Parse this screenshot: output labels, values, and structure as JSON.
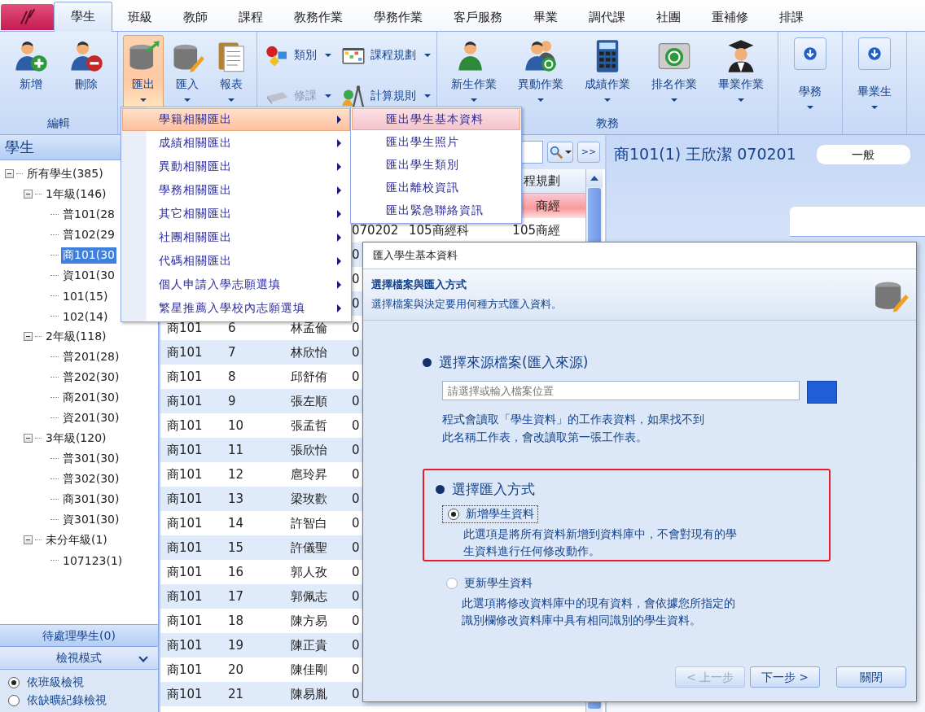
{
  "ribbon": {
    "tabs": [
      {
        "label": "學生",
        "selected": true
      },
      {
        "label": "班級",
        "selected": false
      },
      {
        "label": "教師",
        "selected": false
      },
      {
        "label": "課程",
        "selected": false
      },
      {
        "label": "教務作業",
        "selected": false
      },
      {
        "label": "學務作業",
        "selected": false
      },
      {
        "label": "客戶服務",
        "selected": false
      },
      {
        "label": "畢業",
        "selected": false
      },
      {
        "label": "調代課",
        "selected": false
      },
      {
        "label": "社團",
        "selected": false
      },
      {
        "label": "重補修",
        "selected": false
      },
      {
        "label": "排課",
        "selected": false
      }
    ],
    "groups": [
      {
        "label": "編輯",
        "buttons": [
          {
            "label": "新增",
            "kind": "large",
            "dropdown": false,
            "pressed": false,
            "disabled": false
          },
          {
            "label": "刪除",
            "kind": "large",
            "dropdown": false,
            "pressed": false,
            "disabled": false
          }
        ]
      },
      {
        "buttons": [
          {
            "label": "匯出",
            "kind": "large",
            "dropdown": true,
            "pressed": true,
            "disabled": false
          },
          {
            "label": "匯入",
            "kind": "large",
            "dropdown": true,
            "pressed": false,
            "disabled": false
          },
          {
            "label": "報表",
            "kind": "large",
            "dropdown": true,
            "pressed": false,
            "disabled": false
          }
        ]
      },
      {
        "buttons": [
          {
            "label": "類別",
            "kind": "small",
            "dropdown": true,
            "pressed": false,
            "disabled": false
          },
          {
            "label": "修課",
            "kind": "small",
            "dropdown": true,
            "pressed": false,
            "disabled": true
          },
          {
            "label": "課程規劃",
            "kind": "small",
            "dropdown": true,
            "pressed": false,
            "disabled": false
          },
          {
            "label": "計算規則",
            "kind": "small",
            "dropdown": true,
            "pressed": false,
            "disabled": false
          }
        ]
      },
      {
        "label": "教務",
        "buttons": [
          {
            "label": "新生作業",
            "kind": "large",
            "dropdown": true,
            "pressed": false,
            "disabled": false
          },
          {
            "label": "異動作業",
            "kind": "large",
            "dropdown": true,
            "pressed": false,
            "disabled": false
          },
          {
            "label": "成績作業",
            "kind": "large",
            "dropdown": true,
            "pressed": false,
            "disabled": false
          },
          {
            "label": "排名作業",
            "kind": "large",
            "dropdown": true,
            "pressed": false,
            "disabled": false
          },
          {
            "label": "畢業作業",
            "kind": "large",
            "dropdown": true,
            "pressed": false,
            "disabled": false
          }
        ]
      },
      {
        "buttons": [
          {
            "label": "學務",
            "kind": "boxed",
            "dropdown": true,
            "pressed": false,
            "disabled": false
          }
        ]
      },
      {
        "buttons": [
          {
            "label": "畢業生",
            "kind": "boxed",
            "dropdown": true,
            "pressed": false,
            "disabled": false
          }
        ]
      }
    ]
  },
  "student_panel": {
    "title": "學生",
    "tree": [
      {
        "label": "所有學生(385)",
        "expanded": true,
        "selected": false,
        "children": [
          {
            "label": "1年級(146)",
            "expanded": true,
            "selected": false,
            "children": [
              {
                "label": "普101(28",
                "selected": false
              },
              {
                "label": "普102(29",
                "selected": false
              },
              {
                "label": "商101(30",
                "selected": true
              },
              {
                "label": "資101(30",
                "selected": false
              },
              {
                "label": "101(15)",
                "selected": false
              },
              {
                "label": "102(14)",
                "selected": false
              }
            ]
          },
          {
            "label": "2年級(118)",
            "expanded": true,
            "selected": false,
            "children": [
              {
                "label": "普201(28)",
                "selected": false
              },
              {
                "label": "普202(30)",
                "selected": false
              },
              {
                "label": "商201(30)",
                "selected": false
              },
              {
                "label": "資201(30)",
                "selected": false
              }
            ]
          },
          {
            "label": "3年級(120)",
            "expanded": true,
            "selected": false,
            "children": [
              {
                "label": "普301(30)",
                "selected": false
              },
              {
                "label": "普302(30)",
                "selected": false
              },
              {
                "label": "商301(30)",
                "selected": false
              },
              {
                "label": "資301(30)",
                "selected": false
              }
            ]
          },
          {
            "label": "未分年級(1)",
            "expanded": true,
            "selected": false,
            "children": [
              {
                "label": "107123(1)",
                "selected": false
              }
            ]
          }
        ]
      }
    ],
    "pending_button": "待處理學生(0)",
    "view_mode": {
      "title": "檢視模式",
      "options": [
        {
          "label": "依班級檢視",
          "selected": true
        },
        {
          "label": "依缺曠紀錄檢視",
          "selected": false
        }
      ]
    }
  },
  "student_list": {
    "more_button": ">>",
    "heading": {
      "column_6": "程規劃"
    },
    "rows": [
      {
        "selected": true,
        "cells": {
          "column_6": "商經"
        }
      },
      {
        "selected": false,
        "cells": {
          "column_4": "070202",
          "column_5": "105商經科",
          "column_6": "105商經"
        }
      },
      {
        "selected": false,
        "cells": {
          "column_4": "0"
        }
      },
      {
        "selected": false,
        "cells": {
          "column_4": "0"
        }
      },
      {
        "selected": false,
        "cells": {
          "column_4": "0"
        }
      },
      {
        "selected": false,
        "cells": {
          "column_1": "商101",
          "column_2": "6",
          "column_3": "林孟倫",
          "column_4": "0"
        }
      },
      {
        "selected": false,
        "cells": {
          "column_1": "商101",
          "column_2": "7",
          "column_3": "林欣怡",
          "column_4": "0"
        }
      },
      {
        "selected": false,
        "cells": {
          "column_1": "商101",
          "column_2": "8",
          "column_3": "邱舒侑",
          "column_4": "0"
        }
      },
      {
        "selected": false,
        "cells": {
          "column_1": "商101",
          "column_2": "9",
          "column_3": "張左順",
          "column_4": "0"
        }
      },
      {
        "selected": false,
        "cells": {
          "column_1": "商101",
          "column_2": "10",
          "column_3": "張孟哲",
          "column_4": "0"
        }
      },
      {
        "selected": false,
        "cells": {
          "column_1": "商101",
          "column_2": "11",
          "column_3": "張欣怡",
          "column_4": "0"
        }
      },
      {
        "selected": false,
        "cells": {
          "column_1": "商101",
          "column_2": "12",
          "column_3": "扈玲昇",
          "column_4": "0"
        }
      },
      {
        "selected": false,
        "cells": {
          "column_1": "商101",
          "column_2": "13",
          "column_3": "梁玫歡",
          "column_4": "0"
        }
      },
      {
        "selected": false,
        "cells": {
          "column_1": "商101",
          "column_2": "14",
          "column_3": "許智白",
          "column_4": "0"
        }
      },
      {
        "selected": false,
        "cells": {
          "column_1": "商101",
          "column_2": "15",
          "column_3": "許儀聖",
          "column_4": "0"
        }
      },
      {
        "selected": false,
        "cells": {
          "column_1": "商101",
          "column_2": "16",
          "column_3": "郭人孜",
          "column_4": "0"
        }
      },
      {
        "selected": false,
        "cells": {
          "column_1": "商101",
          "column_2": "17",
          "column_3": "郭佩志",
          "column_4": "0"
        }
      },
      {
        "selected": false,
        "cells": {
          "column_1": "商101",
          "column_2": "18",
          "column_3": "陳方易",
          "column_4": "0"
        }
      },
      {
        "selected": false,
        "cells": {
          "column_1": "商101",
          "column_2": "19",
          "column_3": "陳正貴",
          "column_4": "0"
        }
      },
      {
        "selected": false,
        "cells": {
          "column_1": "商101",
          "column_2": "20",
          "column_3": "陳佳剛",
          "column_4": "0"
        }
      },
      {
        "selected": false,
        "cells": {
          "column_1": "商101",
          "column_2": "21",
          "column_3": "陳易胤",
          "column_4": "0"
        }
      }
    ]
  },
  "student_header": {
    "title": "商101(1) 王欣潔 070201",
    "category": "一般"
  },
  "export_menu": {
    "items": [
      {
        "label": "學籍相關匯出",
        "selected": true
      },
      {
        "label": "成績相關匯出",
        "selected": false
      },
      {
        "label": "異動相關匯出",
        "selected": false
      },
      {
        "label": "學務相關匯出",
        "selected": false
      },
      {
        "label": "其它相關匯出",
        "selected": false
      },
      {
        "label": "社團相關匯出",
        "selected": false
      },
      {
        "label": "代碼相關匯出",
        "selected": false
      },
      {
        "label": "個人申請入學志願選填",
        "selected": false
      },
      {
        "label": "繁星推薦入學校內志願選填",
        "selected": false
      }
    ]
  },
  "export_submenu": {
    "items": [
      {
        "label": "匯出學生基本資料",
        "selected": true
      },
      {
        "label": "匯出學生照片",
        "selected": false
      },
      {
        "label": "匯出學生類別",
        "selected": false
      },
      {
        "label": "匯出離校資訊",
        "selected": false
      },
      {
        "label": "匯出緊急聯絡資訊",
        "selected": false
      }
    ]
  },
  "dialog": {
    "title": "匯入學生基本資料",
    "step_title": "選擇檔案與匯入方式",
    "step_description": "選擇檔案與決定要用何種方式匯入資料。",
    "source": {
      "heading": "選擇來源檔案(匯入來源)",
      "placeholder": "請選擇或輸入檔案位置",
      "note": "程式會讀取「學生資料」的工作表資料，如果找不到此名稱工作表，會改讀取第一張工作表。"
    },
    "mode": {
      "heading": "選擇匯入方式",
      "options": [
        {
          "label": "新增學生資料",
          "selected": true,
          "description": "此選項是將所有資料新增到資料庫中，不會對現有的學生資料進行任何修改動作。"
        },
        {
          "label": "更新學生資料",
          "selected": false,
          "description": "此選項將修改資料庫中的現有資料，會依據您所指定的識別欄修改資料庫中具有相同識別的學生資料。"
        }
      ]
    },
    "buttons": [
      {
        "label": "< 上一步",
        "disabled": true
      },
      {
        "label": "下一步 >",
        "disabled": false
      },
      {
        "label": "關閉",
        "disabled": false
      }
    ]
  }
}
